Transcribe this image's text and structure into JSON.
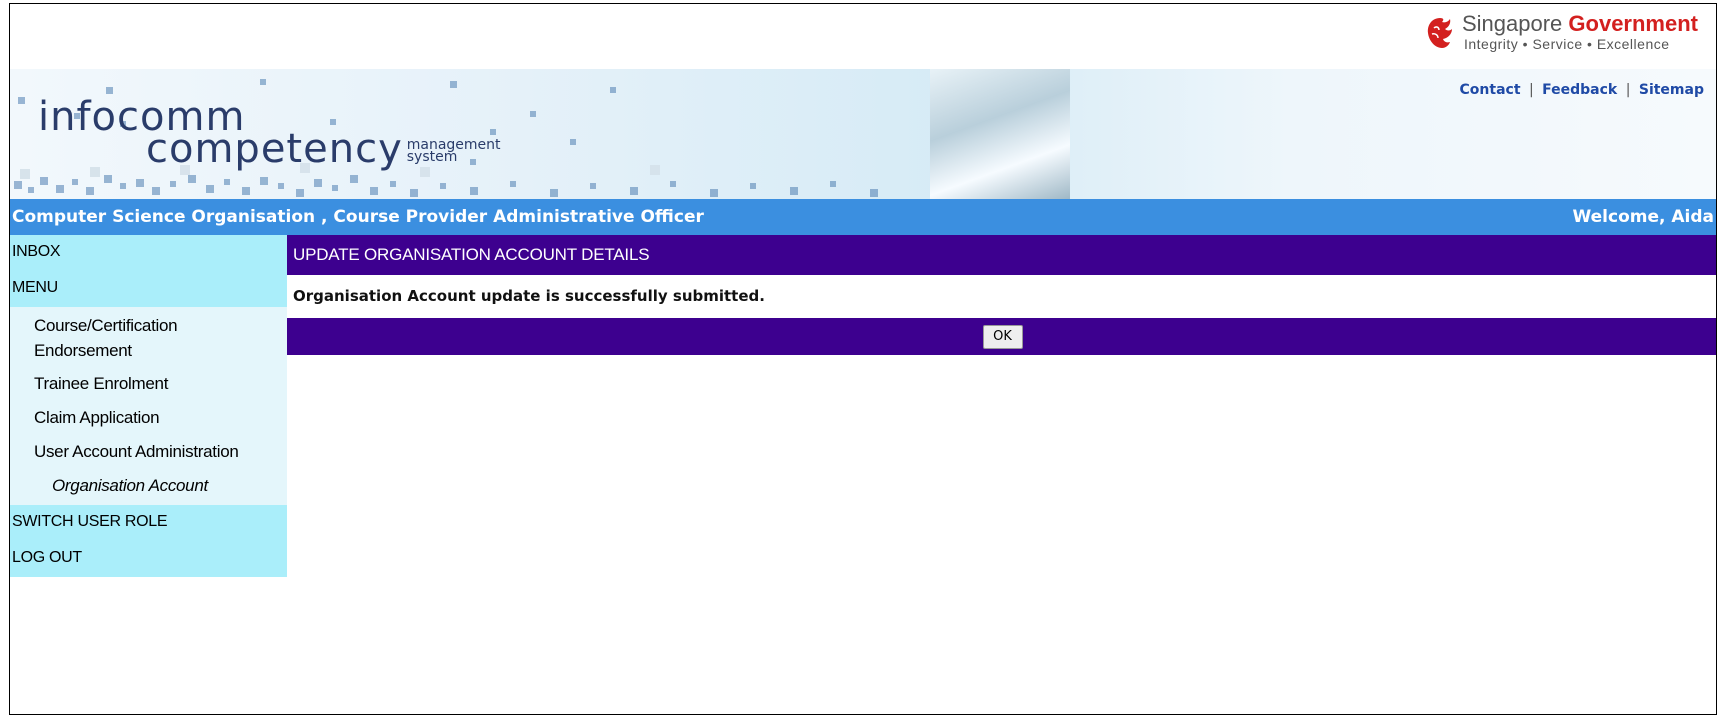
{
  "gov": {
    "name_part1": "Singapore",
    "name_part2": "Government",
    "tagline": "Integrity • Service • Excellence"
  },
  "brand": {
    "logo_word1": "infocomm",
    "logo_word2": "competency",
    "logo_small1": "management",
    "logo_small2": "system"
  },
  "top_links": {
    "contact": "Contact",
    "feedback": "Feedback",
    "sitemap": "Sitemap",
    "separator": "|"
  },
  "userbar": {
    "org_role": "Computer Science Organisation , Course Provider Administrative Officer",
    "welcome": "Welcome, Aida"
  },
  "sidebar": {
    "inbox": "INBOX",
    "menu": "MENU",
    "items": [
      {
        "label": "Course/Certification Endorsement"
      },
      {
        "label": "Trainee Enrolment"
      },
      {
        "label": "Claim Application"
      },
      {
        "label": "User Account Administration"
      }
    ],
    "sub_item": "Organisation Account",
    "switch_role": "SWITCH USER ROLE",
    "logout": "LOG OUT"
  },
  "panel": {
    "title": "UPDATE ORGANISATION ACCOUNT DETAILS",
    "message": "Organisation Account update is successfully submitted.",
    "ok_label": "OK"
  },
  "colors": {
    "userbar": "#3b8fe0",
    "panel_bar": "#3d008f",
    "sidebar_head": "#aaeefa",
    "sidebar_menu": "#e4f6fb",
    "link": "#1f4aa6",
    "gov_red": "#d3201f"
  }
}
